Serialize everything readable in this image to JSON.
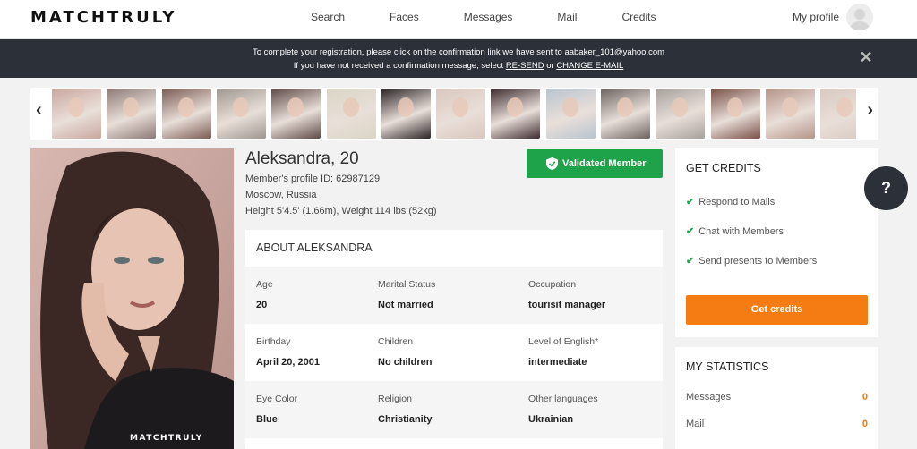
{
  "brand": {
    "logo": "MATCHTRULY"
  },
  "nav": {
    "items": [
      "Search",
      "Faces",
      "Messages",
      "Mail",
      "Credits"
    ],
    "profile_label": "My profile"
  },
  "banner": {
    "line1": "To complete your registration, please click on the confirmation link we have sent to aabaker_101@yahoo.com",
    "line2_prefix": "If you have not received a confirmation message, select ",
    "resend": "RE-SEND",
    "or": " or ",
    "change_email": "CHANGE E-MAIL"
  },
  "carousel": {
    "icons": {
      "prev": "chevron-left-icon",
      "next": "chevron-right-icon"
    },
    "thumb_colors": [
      "#c9a79e",
      "#8d7a76",
      "#7b5b52",
      "#9e9690",
      "#5f4a47",
      "#d8d6c4",
      "#2a2426",
      "#d9c7bd",
      "#3d2b30",
      "#b8c4d0",
      "#6d6460",
      "#a6a09c",
      "#7a5148",
      "#b59489",
      "#d9c9c0"
    ]
  },
  "profile": {
    "name": "Aleksandra, 20",
    "profile_id": "Member's profile ID: 62987129",
    "location": "Moscow, Russia",
    "physical": "Height 5'4.5' (1.66m), Weight 114 lbs (52kg)",
    "validated": "Validated Member",
    "photo_watermark": "MATCHTRULY"
  },
  "about": {
    "title": "ABOUT ALEKSANDRA",
    "rows": [
      [
        {
          "k": "Age",
          "v": "20"
        },
        {
          "k": "Marital Status",
          "v": "Not married"
        },
        {
          "k": "Occupation",
          "v": "tourisit manager"
        }
      ],
      [
        {
          "k": "Birthday",
          "v": "April 20, 2001"
        },
        {
          "k": "Children",
          "v": "No children"
        },
        {
          "k": "Level of English*",
          "v": "intermediate"
        }
      ],
      [
        {
          "k": "Eye Color",
          "v": "Blue"
        },
        {
          "k": "Religion",
          "v": "Christianity"
        },
        {
          "k": "Other languages",
          "v": "Ukrainian"
        }
      ]
    ]
  },
  "credits": {
    "title": "GET CREDITS",
    "features": [
      "Respond to Mails",
      "Chat with Members",
      "Send presents to Members"
    ],
    "button": "Get credits"
  },
  "stats": {
    "title": "MY STATISTICS",
    "items": [
      {
        "label": "Messages",
        "value": "0"
      },
      {
        "label": "Mail",
        "value": "0"
      }
    ]
  },
  "help": {
    "label": "?"
  },
  "colors": {
    "green": "#1ea24a",
    "orange": "#f57c12",
    "dark": "#2c3038"
  }
}
